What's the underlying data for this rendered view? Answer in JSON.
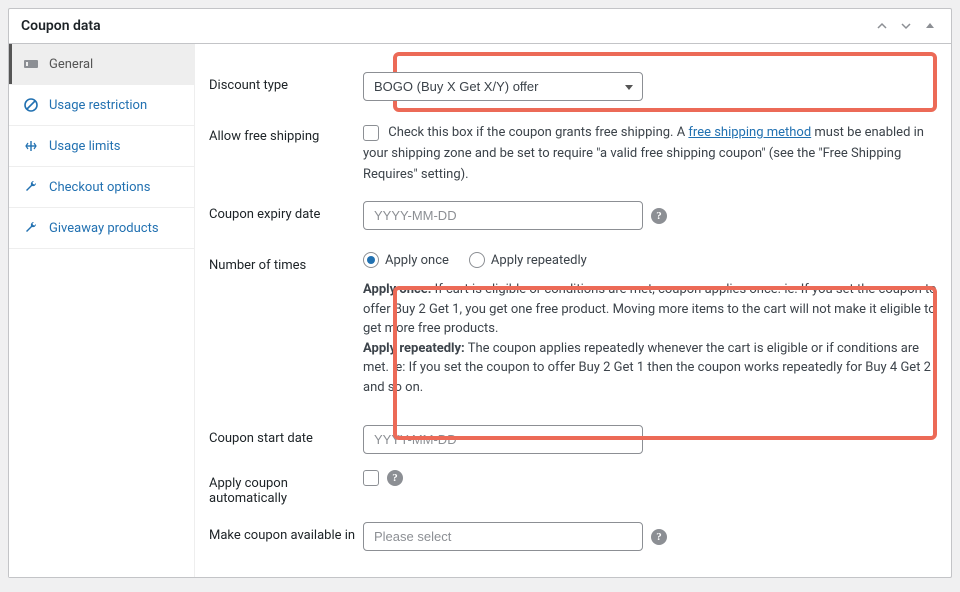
{
  "panel": {
    "title": "Coupon data"
  },
  "tabs": [
    {
      "label": "General"
    },
    {
      "label": "Usage restriction"
    },
    {
      "label": "Usage limits"
    },
    {
      "label": "Checkout options"
    },
    {
      "label": "Giveaway products"
    }
  ],
  "fields": {
    "discount_type": {
      "label": "Discount type",
      "value": "BOGO (Buy X Get X/Y) offer"
    },
    "free_shipping": {
      "label": "Allow free shipping",
      "desc_prefix": "Check this box if the coupon grants free shipping. A ",
      "link": "free shipping method",
      "desc_suffix": " must be enabled in your shipping zone and be set to require \"a valid free shipping coupon\" (see the \"Free Shipping Requires\" setting)."
    },
    "expiry": {
      "label": "Coupon expiry date",
      "placeholder": "YYYY-MM-DD"
    },
    "times": {
      "label": "Number of times",
      "once": "Apply once",
      "repeat": "Apply repeatedly",
      "desc_once_strong": "Apply once:",
      "desc_once": " If cart is eligible or conditions are met, coupon applies once. ie: If you set the coupon to offer Buy 2 Get 1, you get one free product. Moving more items to the cart will not make it eligible to get more free products.",
      "desc_repeat_strong": "Apply repeatedly:",
      "desc_repeat": " The coupon applies repeatedly whenever the cart is eligible or if conditions are met. ie: If you set the coupon to offer Buy 2 Get 1 then the coupon works repeatedly for Buy 4 Get 2 and so on."
    },
    "start": {
      "label": "Coupon start date",
      "placeholder": "YYYY-MM-DD"
    },
    "auto": {
      "label": "Apply coupon automatically"
    },
    "avail": {
      "label": "Make coupon available in",
      "placeholder": "Please select"
    }
  }
}
